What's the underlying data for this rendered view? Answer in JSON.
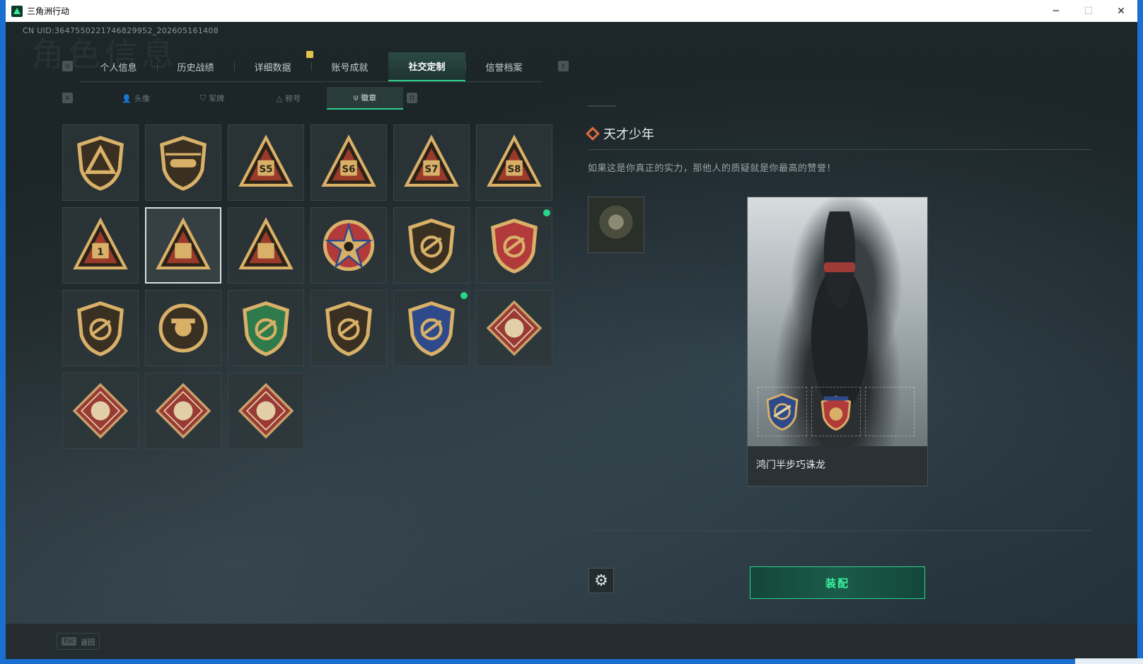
{
  "window": {
    "title": "三角洲行动",
    "minimize": "─",
    "maximize": "☐",
    "close": "✕"
  },
  "header": {
    "uid": "CN UID:3647550221746829952_202605161408",
    "page_title": "角色信息"
  },
  "keys": {
    "prev_tab": "Q",
    "next_tab": "E",
    "prev_sub": "A",
    "next_sub": "D"
  },
  "tabs": [
    {
      "label": "个人信息"
    },
    {
      "label": "历史战绩"
    },
    {
      "label": "详细数据"
    },
    {
      "label": "账号成就"
    },
    {
      "label": "社交定制"
    },
    {
      "label": "信誉档案"
    }
  ],
  "active_tab": "社交定制",
  "subtabs": [
    {
      "label": "头像",
      "icon": "person-icon"
    },
    {
      "label": "军牌",
      "icon": "dogtag-icon"
    },
    {
      "label": "称号",
      "icon": "title-icon"
    },
    {
      "label": "徽章",
      "icon": "badge-icon"
    }
  ],
  "active_subtab": "徽章",
  "badges": [
    {
      "type": "shield-triangle",
      "color": "#b08a4e"
    },
    {
      "type": "shield-helicopter",
      "color": "#b08a4e"
    },
    {
      "type": "tri",
      "label": "S5",
      "color": "#c89a58"
    },
    {
      "type": "tri",
      "label": "S6",
      "color": "#c89a58"
    },
    {
      "type": "tri",
      "label": "S7",
      "color": "#c89a58"
    },
    {
      "type": "tri",
      "label": "S8",
      "color": "#c89a58"
    },
    {
      "type": "tri",
      "label": "1",
      "color": "#c89a58"
    },
    {
      "type": "tri",
      "label": "",
      "color": "#c89a58",
      "selected": true
    },
    {
      "type": "tri",
      "label": "",
      "color": "#c89a58"
    },
    {
      "type": "star-emblem",
      "color": "#b23a3a"
    },
    {
      "type": "shield",
      "color": "#b08a4e"
    },
    {
      "type": "shield-stars",
      "color": "#b23a3a",
      "new": true
    },
    {
      "type": "shield",
      "color": "#b08a4e"
    },
    {
      "type": "round",
      "color": "#b08a4e"
    },
    {
      "type": "shield-green",
      "color": "#2f7a4a"
    },
    {
      "type": "shield",
      "color": "#b08a4e"
    },
    {
      "type": "shield-blue",
      "color": "#2f4a8a",
      "new": true
    },
    {
      "type": "diamond-wolf",
      "color": "#9a3a34"
    },
    {
      "type": "diamond-dragon",
      "color": "#9a3a34"
    },
    {
      "type": "diamond-dragon",
      "color": "#9a3a34"
    },
    {
      "type": "diamond-runner",
      "color": "#9a3a34"
    }
  ],
  "detail": {
    "title": "天才少年",
    "description": "如果这是你真正的实力，那他人的质疑就是你最高的赞誉！",
    "card_name": "鸿门半步巧诛龙"
  },
  "actions": {
    "equip": "装配",
    "settings_icon": "gear-icon"
  },
  "footer": {
    "esc": "Esc",
    "back": "返回"
  },
  "colors": {
    "accent": "#2ecf8f",
    "equip_text": "#3cf2a0",
    "title_diamond": "#e36a3a"
  }
}
